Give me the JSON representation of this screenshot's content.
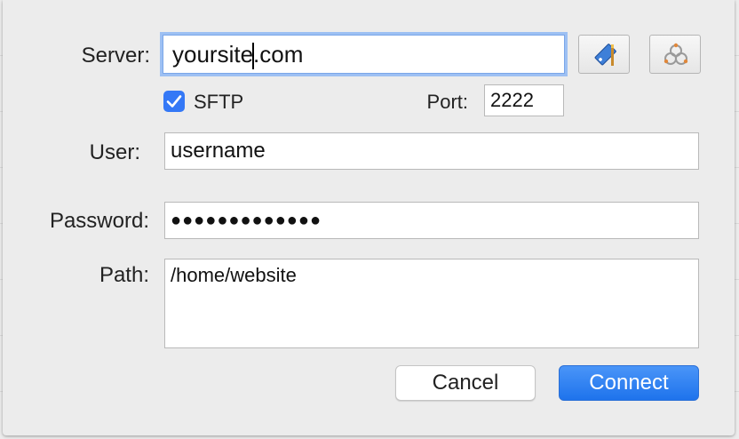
{
  "dialog": {
    "server": {
      "label": "Server:",
      "value_before_caret": "yoursite",
      "value_after_caret": ".com"
    },
    "sftp": {
      "label": "SFTP",
      "checked": true
    },
    "port": {
      "label": "Port:",
      "value": "2222"
    },
    "user": {
      "label": "User:",
      "value": "username"
    },
    "password": {
      "label": "Password:",
      "value": "●●●●●●●●●●●●●"
    },
    "path": {
      "label": "Path:",
      "value": "/home/website"
    },
    "buttons": {
      "cancel": "Cancel",
      "connect": "Connect"
    },
    "icons": {
      "bookmark": "bookmark-tag-icon",
      "network": "network-browse-icon"
    },
    "colors": {
      "accent": "#3478f6",
      "focus_ring": "#9dc0f3"
    }
  }
}
